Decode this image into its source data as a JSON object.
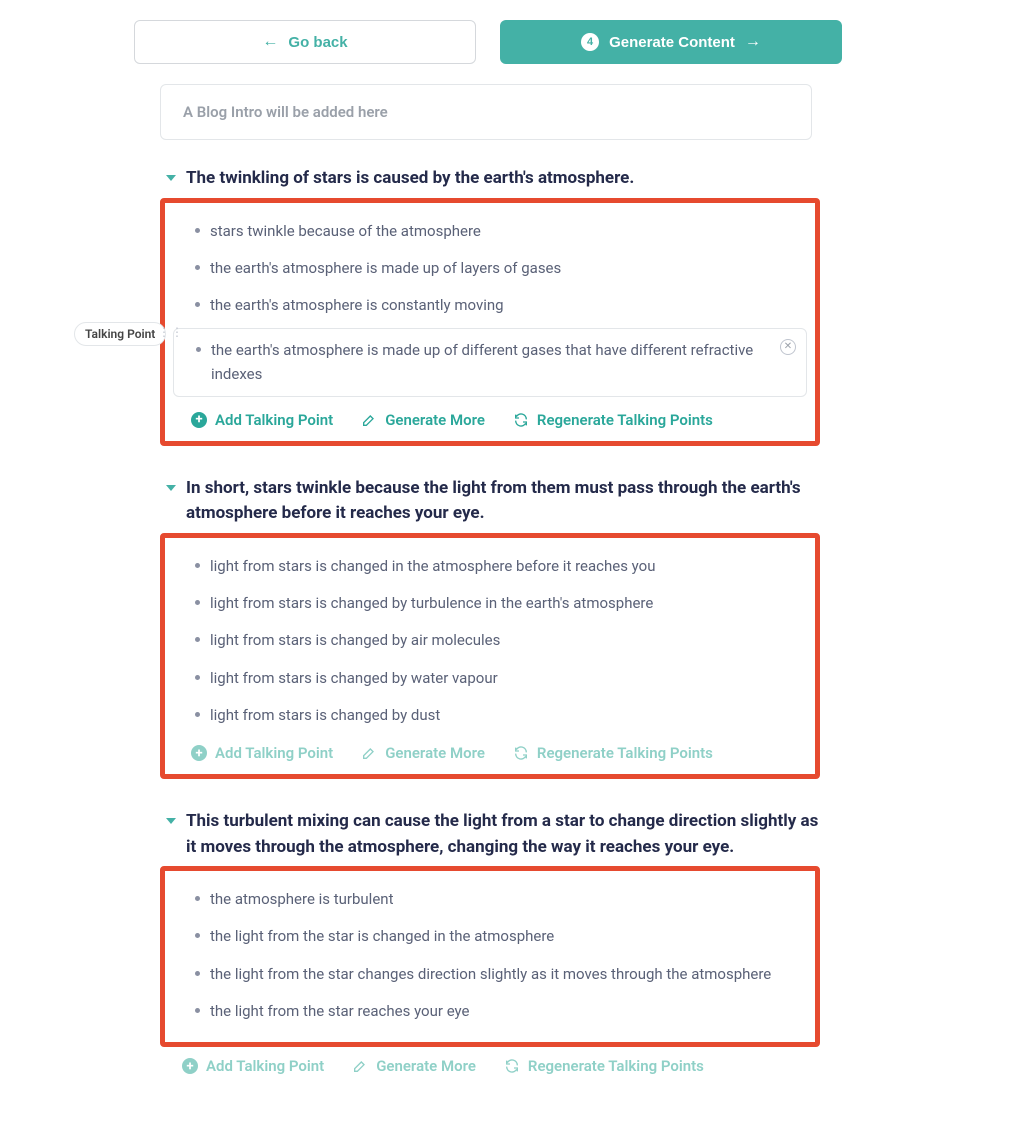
{
  "buttons": {
    "go_back": "Go back",
    "generate_content": "Generate Content",
    "step_number": "4"
  },
  "intro_placeholder": "A Blog Intro will be added here",
  "badge_label": "Talking Point",
  "actions": {
    "add": "Add Talking Point",
    "more": "Generate More",
    "regen": "Regenerate Talking Points"
  },
  "sections": [
    {
      "title": "The twinkling of stars is caused by the earth's atmosphere.",
      "bullets": [
        "stars twinkle because of the atmosphere",
        "the earth's atmosphere is made up of layers of gases",
        "the earth's atmosphere is constantly moving",
        "the earth's atmosphere is made up of different gases that have different refractive indexes"
      ],
      "editing_index": 3,
      "actions_faded": false
    },
    {
      "title": "In short, stars twinkle because the light from them must pass through the earth's atmosphere before it reaches your eye.",
      "bullets": [
        "light from stars is changed in the atmosphere before it reaches you",
        "light from stars is changed by turbulence in the earth's atmosphere",
        "light from stars is changed by air molecules",
        "light from stars is changed by water vapour",
        "light from stars is changed by dust"
      ],
      "editing_index": -1,
      "actions_faded": true
    },
    {
      "title": "This turbulent mixing can cause the light from a star to change direction slightly as it moves through the atmosphere, changing the way it reaches your eye.",
      "bullets": [
        "the atmosphere is turbulent",
        "the light from the star is changed in the atmosphere",
        "the light from the star changes direction slightly as it moves through the atmosphere",
        "the light from the star reaches your eye"
      ],
      "editing_index": -1,
      "actions_faded": true
    }
  ]
}
